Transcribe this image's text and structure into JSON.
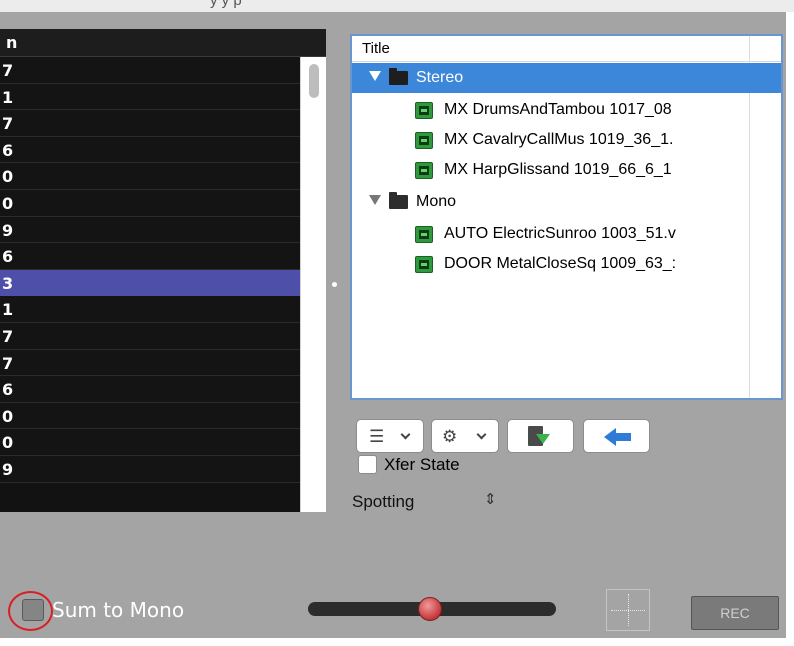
{
  "window": {
    "title_fragment": "y      y p"
  },
  "left_list": {
    "header": "n",
    "rows": [
      "7",
      "1",
      "7",
      "6",
      "0",
      "0",
      "9",
      "6",
      "3",
      "1",
      "7",
      "7",
      "6",
      "0",
      "0",
      "9"
    ],
    "selected_index": 8,
    "colors": {
      "background": "#121212",
      "selected": "#4d4fa8",
      "text": "#ffffff"
    }
  },
  "tree": {
    "column_header": "Title",
    "items": [
      {
        "type": "folder",
        "label": "Stereo",
        "level": 0,
        "expanded": true,
        "selected": true
      },
      {
        "type": "audio",
        "label": "MX DrumsAndTambou 1017_08",
        "level": 1
      },
      {
        "type": "audio",
        "label": "MX CavalryCallMus 1019_36_1.",
        "level": 1
      },
      {
        "type": "audio",
        "label": "MX HarpGlissand 1019_66_6_1",
        "level": 1
      },
      {
        "type": "folder",
        "label": "Mono",
        "level": 0,
        "expanded": true,
        "selected": false
      },
      {
        "type": "audio",
        "label": "AUTO ElectricSunroo 1003_51.v",
        "level": 1
      },
      {
        "type": "audio",
        "label": "DOOR MetalCloseSq 1009_63_:",
        "level": 1
      }
    ],
    "colors": {
      "selection": "#3c87d9",
      "border": "#6a96cf",
      "audio_icon": "#2e9a3b"
    }
  },
  "toolbar": {
    "menu_icon": "list-icon",
    "settings_icon": "gear-icon",
    "export_icon": "export-icon",
    "back_icon": "back-arrow-icon"
  },
  "options": {
    "xfer_state": {
      "label": "Xfer State",
      "checked": false
    },
    "mode_select": {
      "value": "Spotting"
    }
  },
  "bottom": {
    "sum_to_mono": {
      "label": "Sum to Mono",
      "checked": false
    },
    "slider_value": 0.46,
    "rec_label": "REC"
  }
}
